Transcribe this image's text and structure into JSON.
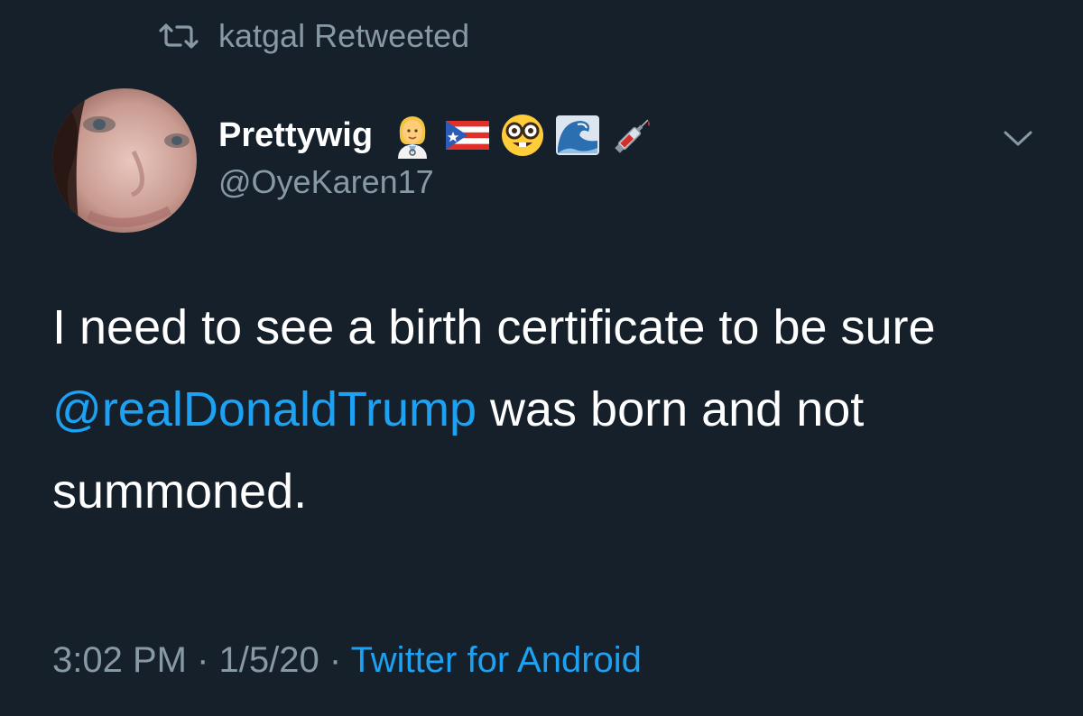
{
  "retweet": {
    "icon": "retweet-icon",
    "text": "katgal Retweeted"
  },
  "author": {
    "display_name": "Prettywig",
    "handle": "@OyeKaren17",
    "avatar": "profile-photo",
    "name_emojis": [
      "woman-health-worker-emoji",
      "puerto-rico-flag-emoji",
      "nerd-face-emoji",
      "water-wave-emoji",
      "syringe-emoji"
    ]
  },
  "menu": {
    "icon": "chevron-down-icon"
  },
  "tweet": {
    "text_part1": "I need to see a birth certificate to be sure ",
    "mention": "@realDonaldTrump",
    "text_part2": " was born and not summoned."
  },
  "meta": {
    "time": "3:02 PM",
    "separator": " · ",
    "date": "1/5/20",
    "source": "Twitter for Android"
  },
  "colors": {
    "background": "#15202b",
    "text": "#ffffff",
    "muted": "#8899a6",
    "accent": "#1da1f2"
  }
}
